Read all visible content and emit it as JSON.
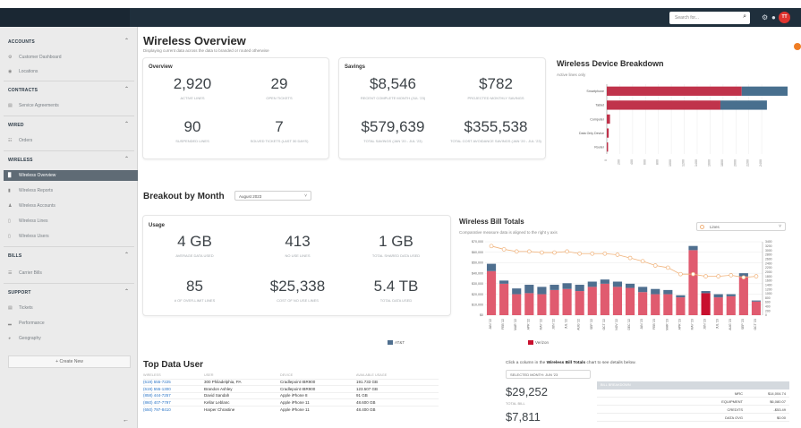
{
  "topbar": {
    "search_placeholder": "Search for...",
    "avatar_initials": "TT"
  },
  "sidebar": {
    "sections": [
      {
        "title": "ACCOUNTS",
        "items": [
          {
            "label": "Customer Dashboard",
            "icon": "gear-icon"
          },
          {
            "label": "Locations",
            "icon": "map-pin-icon"
          }
        ]
      },
      {
        "title": "CONTRACTS",
        "items": [
          {
            "label": "Service Agreements",
            "icon": "document-icon"
          }
        ]
      },
      {
        "title": "WIRED",
        "items": [
          {
            "label": "Orders",
            "icon": "cart-icon"
          }
        ]
      },
      {
        "title": "WIRELESS",
        "items": [
          {
            "label": "Wireless Overview",
            "icon": "chart-icon",
            "active": true
          },
          {
            "label": "Wireless Reports",
            "icon": "report-icon"
          },
          {
            "label": "Wireless Accounts",
            "icon": "users-icon"
          },
          {
            "label": "Wireless Lines",
            "icon": "phone-icon"
          },
          {
            "label": "Wireless Users",
            "icon": "user-icon"
          }
        ]
      },
      {
        "title": "BILLS",
        "items": [
          {
            "label": "Carrier Bills",
            "icon": "bill-icon"
          }
        ]
      },
      {
        "title": "SUPPORT",
        "items": [
          {
            "label": "Tickets",
            "icon": "ticket-icon"
          },
          {
            "label": "Performance",
            "icon": "performance-icon"
          },
          {
            "label": "Geography",
            "icon": "globe-icon"
          }
        ]
      }
    ],
    "create_new": "Create New",
    "collapse_icon": "arrow-left-icon"
  },
  "page": {
    "title": "Wireless Overview",
    "subtitle": "Displaying current data across the data to branded or routed otherwise"
  },
  "overview": {
    "title": "Overview",
    "metrics": [
      {
        "value": "2,920",
        "label": "ACTIVE LINES"
      },
      {
        "value": "29",
        "label": "OPEN TICKETS"
      },
      {
        "value": "90",
        "label": "SUSPENDED LINES"
      },
      {
        "value": "7",
        "label": "SOLVED TICKETS (LAST 30 DAYS)"
      }
    ]
  },
  "savings": {
    "title": "Savings",
    "metrics": [
      {
        "value": "$8,546",
        "label": "RECENT COMPLETE MONTH (JUL '23)"
      },
      {
        "value": "$782",
        "label": "PROJECTED MONTHLY SAVINGS"
      },
      {
        "value": "$579,639",
        "label": "TOTAL SAVINGS (JAN '20 - JUL '23)"
      },
      {
        "value": "$355,538",
        "label": "TOTAL COST AVOIDANCE SAVINGS (JAN '20 - JUL '23)"
      }
    ]
  },
  "device_breakdown": {
    "title": "Wireless Device Breakdown",
    "subtitle": "Active lines only"
  },
  "breakout": {
    "title": "Breakout by Month",
    "month": "August 2023"
  },
  "usage": {
    "title": "Usage",
    "metrics": [
      {
        "value": "4 GB",
        "label": "AVERAGE DATA USED"
      },
      {
        "value": "413",
        "label": "NO USE LINES"
      },
      {
        "value": "1 GB",
        "label": "TOTAL SHARED DATA USED"
      },
      {
        "value": "85",
        "label": "# OF OVER-LIMIT LINES"
      },
      {
        "value": "$25,338",
        "label": "COST OF NO USE LINES"
      },
      {
        "value": "5.4 TB",
        "label": "TOTAL DATA USED"
      }
    ]
  },
  "bill_totals": {
    "title": "Wireless Bill Totals",
    "subtitle": "Comparative measure data is aligned to the right y axis",
    "line_select": "Lines"
  },
  "top_data_user": {
    "title": "Top Data User",
    "columns": [
      "WIRELESS",
      "USER",
      "DEVICE",
      "AVAILABLE USAGE"
    ],
    "rows": [
      [
        "(619) 555-7225",
        "300 Philadelphia, PA",
        "Cradlepoint IBR900",
        "191.733 GB"
      ],
      [
        "(619) 555-1300",
        "Brandon Ashley",
        "Cradlepoint IBR900",
        "123.507 GB"
      ],
      [
        "(858) 444-7257",
        "David Sandah",
        "Apple iPhone 8",
        "91 GB"
      ],
      [
        "(860) 407-7797",
        "Kellar Leblanc",
        "Apple iPhone 11",
        "48.600 GB"
      ],
      [
        "(650) 797-8410",
        "Harper Chrastine",
        "Apple iPhone 11",
        "48.400 GB"
      ]
    ]
  },
  "bill_detail": {
    "hint_prefix": "Click a column in the ",
    "hint_bold": "Wireless Bill Totals",
    "hint_suffix": " chart to see details below.",
    "selected_month": "SELECTED MONTH: JUN '23",
    "total_value": "$29,252",
    "total_label": "TOTAL BILL",
    "second_value": "$7,811",
    "table_header": "BILL BREAKDOWN",
    "rows": [
      {
        "key": "MRC",
        "value": "$14,004.74"
      },
      {
        "key": "EQUIPMENT",
        "value": "$6,080.07"
      },
      {
        "key": "CREDITS",
        "value": "-$53.49"
      },
      {
        "key": "DATA OVG",
        "value": "$0.00"
      }
    ]
  },
  "chart_data": [
    {
      "type": "bar",
      "title": "Wireless Device Breakdown",
      "orientation": "horizontal",
      "stacked": true,
      "categories": [
        "Smartphone",
        "Tablet",
        "Computer",
        "Data Only Device",
        "Router"
      ],
      "series": [
        {
          "name": "Active",
          "color": "#c0334b",
          "values": [
            2090,
            1760,
            50,
            30,
            20
          ]
        },
        {
          "name": "Suspended",
          "color": "#486f8e",
          "values": [
            710,
            720,
            0,
            0,
            0
          ]
        }
      ],
      "xlim": [
        0,
        2800
      ],
      "xticks": [
        "0",
        "200",
        "400",
        "600",
        "800",
        "1000",
        "1200",
        "1400",
        "1600",
        "1800",
        "2000",
        "2200",
        "2400"
      ],
      "grid": true
    },
    {
      "type": "bar",
      "title": "Wireless Bill Totals",
      "stacked": true,
      "categories": [
        "JAN '22",
        "FEB '22",
        "MAR '22",
        "APR '22",
        "MAY '22",
        "JUN '22",
        "JUL '22",
        "AUG '22",
        "SEP '22",
        "OCT '22",
        "NOV '22",
        "DEC '22",
        "JAN '23",
        "FEB '23",
        "MAR '23",
        "APR '23",
        "MAY '23",
        "JUN '23",
        "JUL '23",
        "AUG '23",
        "SEP '23",
        "OCT '23"
      ],
      "ylim": [
        0,
        70000
      ],
      "yticks": [
        "$0",
        "$10,000",
        "$20,000",
        "$30,000",
        "$40,000",
        "$50,000",
        "$60,000",
        "$70,000"
      ],
      "y2lim": [
        0,
        3400
      ],
      "series": [
        {
          "name": "AT&T",
          "color": "#4f6f8f",
          "values": [
            7000,
            3000,
            5500,
            8000,
            7000,
            5000,
            5500,
            6000,
            5000,
            4000,
            5000,
            4000,
            5000,
            5000,
            4000,
            2000,
            4000,
            2000,
            3000,
            2000,
            3000,
            1000
          ]
        },
        {
          "name": "Verizon",
          "color": "#e05b6f",
          "values": [
            42000,
            30000,
            20000,
            21000,
            20000,
            24000,
            25000,
            23000,
            27000,
            30000,
            27000,
            26000,
            22000,
            20000,
            20000,
            17000,
            62000,
            21000,
            17000,
            18000,
            37000,
            13000
          ]
        },
        {
          "name": "Lines",
          "type": "line",
          "color": "#f0b27a",
          "values": [
            3200,
            3050,
            2950,
            2950,
            2900,
            2900,
            2950,
            2850,
            2850,
            2850,
            2800,
            2650,
            2500,
            2300,
            2200,
            1900,
            1900,
            1800,
            1800,
            1850,
            1750,
            1800
          ]
        }
      ],
      "legend": [
        "AT&T",
        "Verizon"
      ],
      "legend_position": "bottom",
      "selected_category": "JUN '23",
      "grid": true
    }
  ]
}
